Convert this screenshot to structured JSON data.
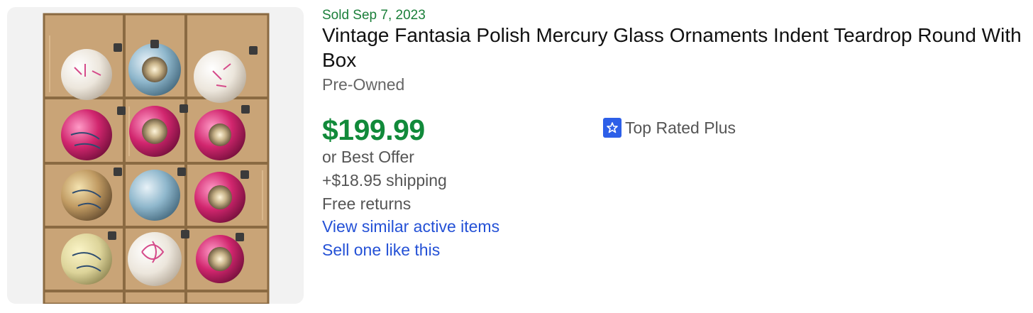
{
  "listing": {
    "sold_label": "Sold Sep 7, 2023",
    "title": "Vintage Fantasia Polish Mercury Glass Ornaments Indent Teardrop Round With Box",
    "condition": "Pre-Owned",
    "price": "$199.99",
    "best_offer": "or Best Offer",
    "shipping": "+$18.95 shipping",
    "returns": "Free returns",
    "view_similar": "View similar active items",
    "sell_one": "Sell one like this",
    "badge": {
      "label": "Top Rated Plus",
      "icon": "ribbon-star-icon"
    },
    "image_subject": "box of glass ornaments",
    "colors": {
      "sold_green": "#1b7f3a",
      "price_green": "#118a3a",
      "link_blue": "#2451d6",
      "badge_blue": "#2d5fe8"
    }
  }
}
